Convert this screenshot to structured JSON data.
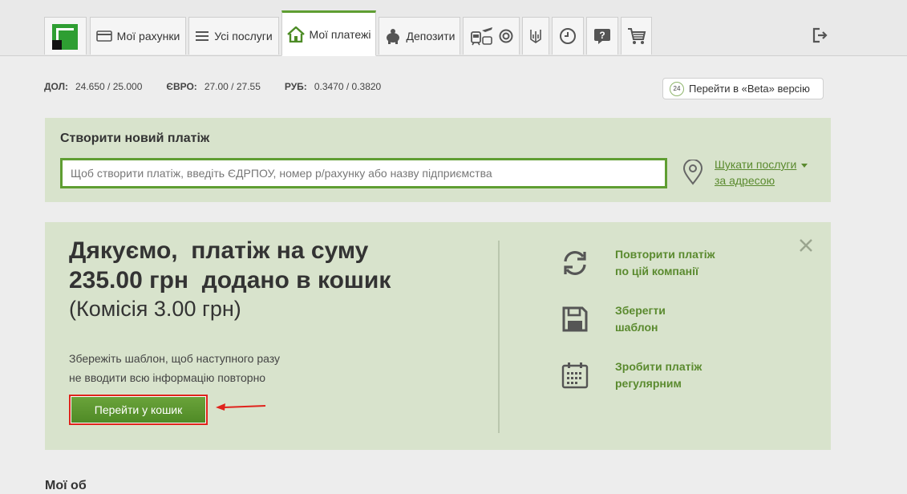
{
  "nav": {
    "tabs": [
      {
        "label": "Мої рахунки"
      },
      {
        "label": "Усі послуги"
      },
      {
        "label": "Мої платежі"
      },
      {
        "label": "Депозити"
      }
    ]
  },
  "rates": [
    {
      "label": "ДОЛ:",
      "value": "24.650 / 25.000"
    },
    {
      "label": "ЄВРО:",
      "value": "27.00 / 27.55"
    },
    {
      "label": "РУБ:",
      "value": "0.3470 / 0.3820"
    }
  ],
  "beta": {
    "badge": "24",
    "label": "Перейти в «Beta» версію"
  },
  "create": {
    "title": "Створити новий платіж",
    "placeholder": "Щоб створити платіж, введіть ЄДРПОУ, номер р/рахунку або назву підприємства",
    "address_line1": "Шукати послуги",
    "address_line2": "за адресою"
  },
  "success": {
    "headline": "Дякуємо,  платіж на суму\n235.00 грн  додано в кошик",
    "commission": "(Комісія 3.00 грн)",
    "hint_line1": "Збережіть шаблон, щоб наступного разу",
    "hint_line2": "не вводити всю інформацію повторно",
    "cart_button": "Перейти у кошик",
    "actions": [
      {
        "line1": "Повторити платіж",
        "line2": "по цій компанії"
      },
      {
        "line1": "Зберегти",
        "line2": "шаблон"
      },
      {
        "line1": "Зробити платіж",
        "line2": "регулярним"
      }
    ]
  },
  "bottom": {
    "title": "Мої об"
  },
  "colors": {
    "accent": "#5f9e32",
    "panel": "#d8e3cc",
    "highlight": "#e0231c"
  }
}
